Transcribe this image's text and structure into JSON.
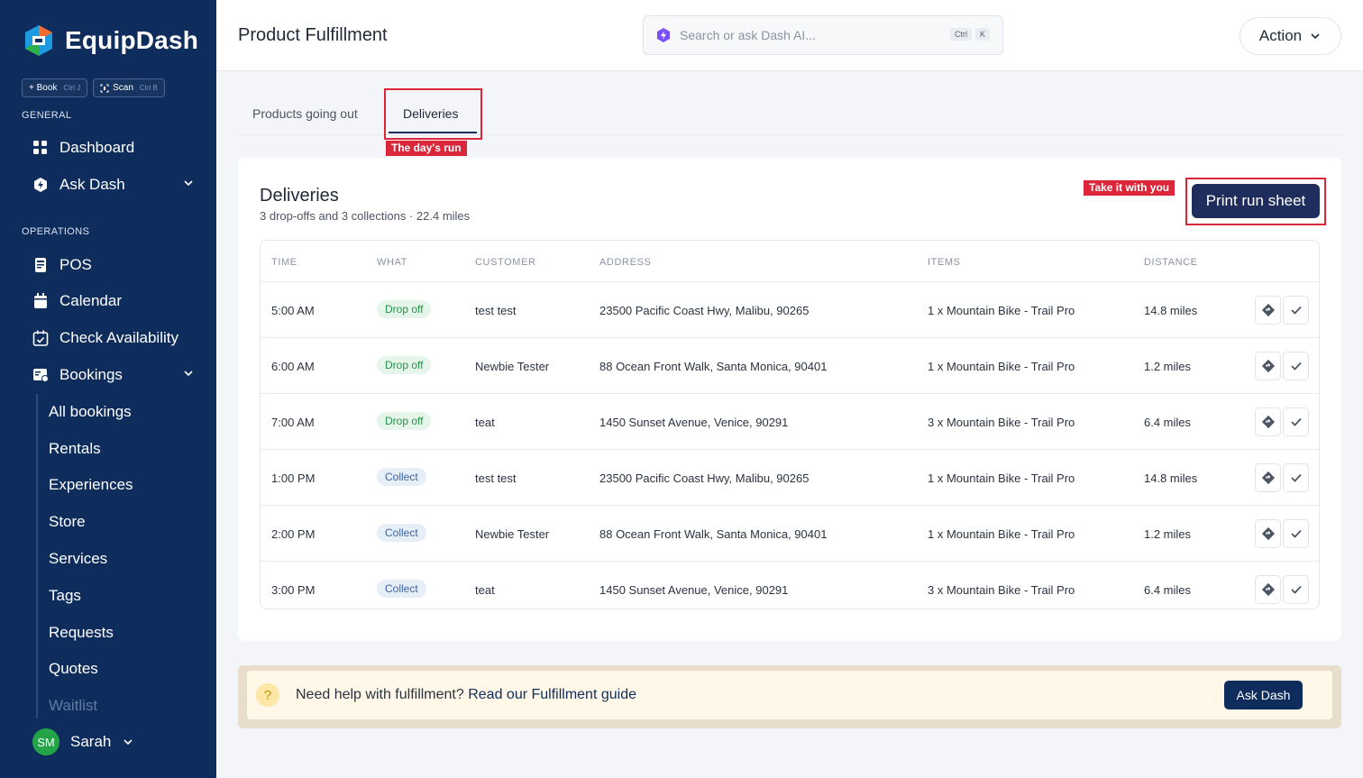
{
  "brand": {
    "name": "EquipDash"
  },
  "sidebar": {
    "quick_actions": [
      {
        "label": "+ Book",
        "shortcut": "Ctrl J"
      },
      {
        "label": "Scan",
        "shortcut": "Ctrl B"
      }
    ],
    "general_label": "GENERAL",
    "general_items": [
      {
        "label": "Dashboard",
        "icon": "grid-icon"
      },
      {
        "label": "Ask Dash",
        "icon": "shield-icon"
      }
    ],
    "operations_label": "OPERATIONS",
    "operations_items": [
      {
        "label": "POS",
        "icon": "printer-icon"
      },
      {
        "label": "Calendar",
        "icon": "calendar-icon"
      },
      {
        "label": "Check Availability",
        "icon": "calendar-check-icon"
      },
      {
        "label": "Bookings",
        "icon": "bookings-icon"
      }
    ],
    "booking_sub_items": [
      "All bookings",
      "Rentals",
      "Experiences",
      "Store",
      "Services",
      "Tags",
      "Requests",
      "Quotes",
      "Waitlist"
    ],
    "user": {
      "initials": "SM",
      "name": "Sarah"
    }
  },
  "header": {
    "title": "Product Fulfillment",
    "search_placeholder": "Search or ask Dash AI...",
    "search_shortcut": [
      "Ctrl",
      "K"
    ],
    "action_label": "Action"
  },
  "tabs": [
    {
      "label": "Products going out",
      "active": false
    },
    {
      "label": "Deliveries",
      "active": true
    }
  ],
  "annotations": {
    "tab_tag": "The day's run",
    "print_tag": "Take it with you"
  },
  "deliveries": {
    "title": "Deliveries",
    "subtitle": "3 drop-offs and 3 collections · 22.4 miles",
    "print_label": "Print run sheet",
    "columns": [
      "TIME",
      "WHAT",
      "CUSTOMER",
      "ADDRESS",
      "ITEMS",
      "DISTANCE"
    ],
    "rows": [
      {
        "time": "5:00 AM",
        "what": "Drop off",
        "customer": "test test",
        "address": "23500  Pacific Coast Hwy, Malibu, 90265",
        "items": "1  x Mountain Bike - Trail Pro",
        "distance": "14.8  miles"
      },
      {
        "time": "6:00 AM",
        "what": "Drop off",
        "customer": "Newbie Tester",
        "address": "88  Ocean Front Walk, Santa Monica, 90401",
        "items": "1  x Mountain Bike - Trail Pro",
        "distance": "1.2  miles"
      },
      {
        "time": "7:00 AM",
        "what": "Drop off",
        "customer": "teat",
        "address": "1450  Sunset Avenue, Venice, 90291",
        "items": "3  x Mountain Bike - Trail Pro",
        "distance": "6.4 miles"
      },
      {
        "time": "1:00 PM",
        "what": "Collect",
        "customer": "test test",
        "address": "23500  Pacific Coast Hwy, Malibu, 90265",
        "items": "1  x Mountain Bike - Trail Pro",
        "distance": "14.8  miles"
      },
      {
        "time": "2:00 PM",
        "what": "Collect",
        "customer": "Newbie Tester",
        "address": "88  Ocean Front Walk, Santa Monica, 90401",
        "items": "1  x Mountain Bike - Trail Pro",
        "distance": "1.2  miles"
      },
      {
        "time": "3:00 PM",
        "what": "Collect",
        "customer": "teat",
        "address": "1450  Sunset Avenue, Venice, 90291",
        "items": "3  x Mountain Bike - Trail Pro",
        "distance": "6.4 miles"
      }
    ]
  },
  "help": {
    "text": "Need help with fulfillment?",
    "link": "Read our Fulfillment guide",
    "button": "Ask Dash"
  },
  "colors": {
    "sidebar": "#0f2d5c",
    "accent": "#1f2d5c",
    "highlight": "#dc2639",
    "drop_badge": "#23944a",
    "collect_badge": "#3a64a8"
  }
}
